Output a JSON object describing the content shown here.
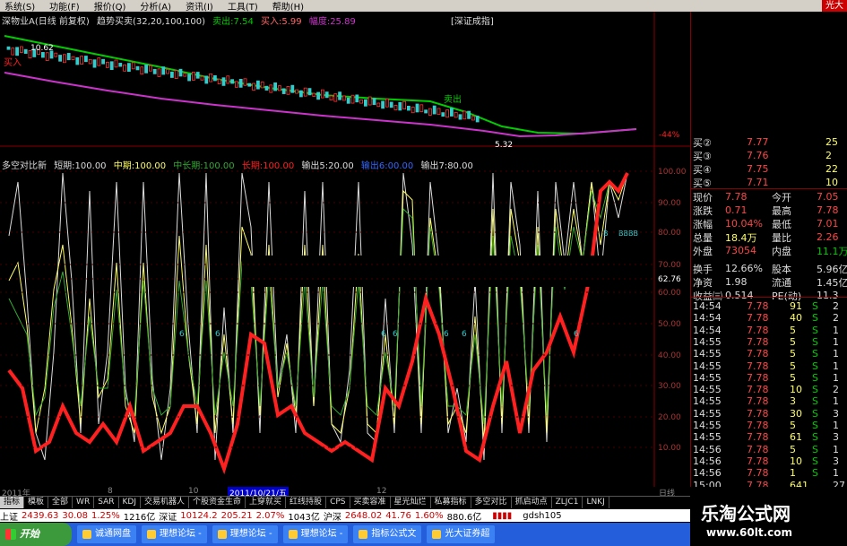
{
  "menu": {
    "items": [
      "系统(S)",
      "功能(F)",
      "报价(Q)",
      "分析(A)",
      "资讯(I)",
      "工具(T)",
      "帮助(H)"
    ],
    "brand": "光大"
  },
  "main_chart": {
    "stock_title": "深物业A(日线 前复权)",
    "indicator": "趋势买卖(32,20,100,100)",
    "sell_label": "卖出:7.54",
    "buy_label": "买入:5.99",
    "width_label": "幅度:25.89",
    "index_label": "[深证成指]",
    "high_label": "10.62",
    "low_label": "5.32",
    "buy_marker": "买入",
    "sell_marker": "卖出",
    "pct_label": "-44%"
  },
  "sub_chart": {
    "name": "多空对比新",
    "short": "短期:100.00",
    "mid": "中期:100.00",
    "midlong": "中长期:100.00",
    "long": "长期:100.00",
    "out1": "输出5:20.00",
    "out2": "输出6:00.00",
    "out3": "输出7:80.00",
    "axis_ticks": [
      "100.00",
      "90.00",
      "80.00",
      "70.00",
      "62.76",
      "60.00",
      "50.00",
      "40.00",
      "30.00",
      "20.00",
      "10.00"
    ],
    "label_b": "B",
    "label_bbbb": "BBBB",
    "six_labels": [
      "6",
      "6",
      "6",
      "6",
      "6",
      "6",
      "6"
    ]
  },
  "date_bar": {
    "left": "2011年",
    "mid1": "8",
    "mid2": "10",
    "cursor": "2011/10/21/五",
    "mid3": "12",
    "right": "日线"
  },
  "quote": {
    "buy_rows": [
      {
        "label": "买②",
        "price": "7.77",
        "vol": "25"
      },
      {
        "label": "买③",
        "price": "7.76",
        "vol": "2"
      },
      {
        "label": "买④",
        "price": "7.75",
        "vol": "22"
      },
      {
        "label": "买⑤",
        "price": "7.71",
        "vol": "10"
      }
    ],
    "stats": [
      {
        "l1": "现价",
        "v1": "7.78",
        "l2": "今开",
        "v2": "7.05"
      },
      {
        "l1": "涨跌",
        "v1": "0.71",
        "l2": "最高",
        "v2": "7.78"
      },
      {
        "l1": "涨幅",
        "v1": "10.04%",
        "l2": "最低",
        "v2": "7.01"
      },
      {
        "l1": "总量",
        "v1": "18.4万",
        "l2": "量比",
        "v2": "2.26"
      },
      {
        "l1": "外盘",
        "v1": "73054",
        "l2": "内盘",
        "v2": "11.1万"
      },
      {
        "l1": "换手",
        "v1": "12.66%",
        "l2": "股本",
        "v2": "5.96亿"
      },
      {
        "l1": "净资",
        "v1": "1.98",
        "l2": "流通",
        "v2": "1.45亿"
      },
      {
        "l1": "收益㈢",
        "v1": "0.514",
        "l2": "PE(动)",
        "v2": "11.3"
      }
    ],
    "ticks": [
      {
        "t": "14:54",
        "p": "7.78",
        "v": "91",
        "s": "S",
        "n": "2"
      },
      {
        "t": "14:54",
        "p": "7.78",
        "v": "40",
        "s": "S",
        "n": "2"
      },
      {
        "t": "14:54",
        "p": "7.78",
        "v": "5",
        "s": "S",
        "n": "1"
      },
      {
        "t": "14:55",
        "p": "7.78",
        "v": "5",
        "s": "S",
        "n": "1"
      },
      {
        "t": "14:55",
        "p": "7.78",
        "v": "5",
        "s": "S",
        "n": "1"
      },
      {
        "t": "14:55",
        "p": "7.78",
        "v": "5",
        "s": "S",
        "n": "1"
      },
      {
        "t": "14:55",
        "p": "7.78",
        "v": "5",
        "s": "S",
        "n": "1"
      },
      {
        "t": "14:55",
        "p": "7.78",
        "v": "10",
        "s": "S",
        "n": "2"
      },
      {
        "t": "14:55",
        "p": "7.78",
        "v": "3",
        "s": "S",
        "n": "1"
      },
      {
        "t": "14:55",
        "p": "7.78",
        "v": "30",
        "s": "S",
        "n": "3"
      },
      {
        "t": "14:55",
        "p": "7.78",
        "v": "5",
        "s": "S",
        "n": "1"
      },
      {
        "t": "14:55",
        "p": "7.78",
        "v": "61",
        "s": "S",
        "n": "3"
      },
      {
        "t": "14:56",
        "p": "7.78",
        "v": "5",
        "s": "S",
        "n": "1"
      },
      {
        "t": "14:56",
        "p": "7.78",
        "v": "10",
        "s": "S",
        "n": "3"
      },
      {
        "t": "14:56",
        "p": "7.78",
        "v": "1",
        "s": "S",
        "n": "1"
      },
      {
        "t": "15:00",
        "p": "7.78",
        "v": "641",
        "s": "",
        "n": "27"
      }
    ]
  },
  "tabs": [
    "指标",
    "模板",
    "全部",
    "WR",
    "SAR",
    "KDJ",
    "交易机器人",
    "个股资金生命",
    "上穿就买",
    "红线持股",
    "CPS",
    "买卖容准",
    "星光灿烂",
    "私募指标",
    "多空对比",
    "抓启动点",
    "ZLJC1",
    "LNKJ"
  ],
  "index_bar": {
    "sh_label": "上证",
    "sh_val": "2439.63",
    "sh_chg": "30.08",
    "sh_pct": "1.25%",
    "sh_amt": "1216亿",
    "sz_label": "深证",
    "sz_val": "10124.2",
    "sz_chg": "205.21",
    "sz_pct": "2.07%",
    "sz_amt": "1043亿",
    "hs_label": "沪深",
    "hs_val": "2648.02",
    "hs_chg": "41.76",
    "hs_pct": "1.60%",
    "hs_amt": "880.6亿",
    "user": "gdsh105"
  },
  "taskbar": {
    "start": "开始",
    "tasks": [
      "诚通网盘",
      "理想论坛 -",
      "理想论坛 -",
      "理想论坛 -",
      "指标公式文",
      "光大证券超"
    ]
  },
  "watermark": {
    "title": "乐淘公式网",
    "url": "www.60lt.com"
  },
  "colors": {
    "red": "#ff2020",
    "green": "#00cc00",
    "yellow": "#ffff66",
    "magenta": "#cc33cc",
    "cyan": "#33cccc"
  }
}
